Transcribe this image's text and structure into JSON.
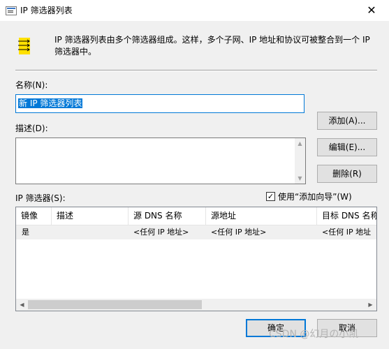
{
  "window": {
    "title": "IP 筛选器列表",
    "close_glyph": "✕",
    "description": "IP 筛选器列表由多个筛选器组成。这样，多个子网、IP 地址和协议可被整合到一个 IP 筛选器中。"
  },
  "form": {
    "name_label": "名称(N):",
    "name_value": "新 IP 筛选器列表",
    "description_label": "描述(D):",
    "description_value": ""
  },
  "buttons": {
    "add": "添加(A)...",
    "edit": "编辑(E)...",
    "remove": "删除(R)",
    "ok": "确定",
    "cancel": "取消"
  },
  "filters": {
    "label": "IP 筛选器(S):",
    "wizard_checkbox_label": "使用“添加向导”(W)",
    "wizard_checked": true,
    "columns": [
      "镜像",
      "描述",
      "源 DNS 名称",
      "源地址",
      "目标 DNS 名称"
    ],
    "rows": [
      [
        "是",
        "",
        "<任何 IP 地址>",
        "<任何 IP 地址>",
        "<任何 IP 地址"
      ]
    ]
  },
  "icons": {
    "app": "window-icon",
    "description": "filter-list-icon"
  },
  "colors": {
    "accent": "#0078d7",
    "dialog_bg": "#f0f0f0",
    "row_bg": "#f0f0f0",
    "button_bg": "#e1e1e1",
    "icon_yellow": "#ffe000"
  },
  "watermark": "CSDN @幻月の小凯"
}
